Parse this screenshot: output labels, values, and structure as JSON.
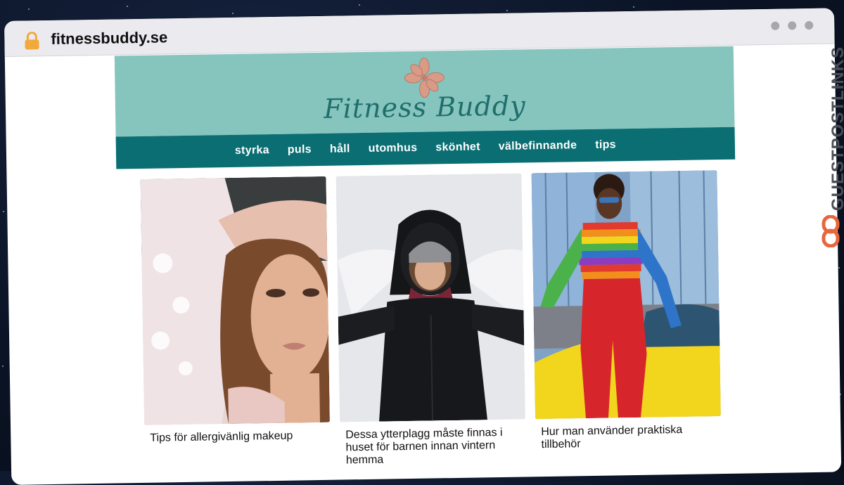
{
  "browser": {
    "url": "fitnessbuddy.se"
  },
  "site": {
    "logo_text": "Fitness Buddy",
    "nav": [
      "styrka",
      "puls",
      "håll",
      "utomhus",
      "skönhet",
      "välbefinnande",
      "tips"
    ]
  },
  "cards": [
    {
      "title": "Tips för allergivänlig makeup",
      "image": "woman-makeup-portrait"
    },
    {
      "title": "Dessa ytterplagg måste finnas i huset för barnen innan vintern hemma",
      "image": "woman-snow-jacket"
    },
    {
      "title": "Hur man använder praktiska tillbehör",
      "image": "woman-rainbow-sweater-yellow-car"
    }
  ],
  "badge": {
    "text": "GUESTPOSTLINKS",
    "icon": "link-icon",
    "accent": "#e8663d"
  },
  "colors": {
    "header_bg": "#86c4be",
    "nav_bg": "#0a6e72",
    "logo_text": "#1f6e6b",
    "flower": "#d99a86"
  }
}
